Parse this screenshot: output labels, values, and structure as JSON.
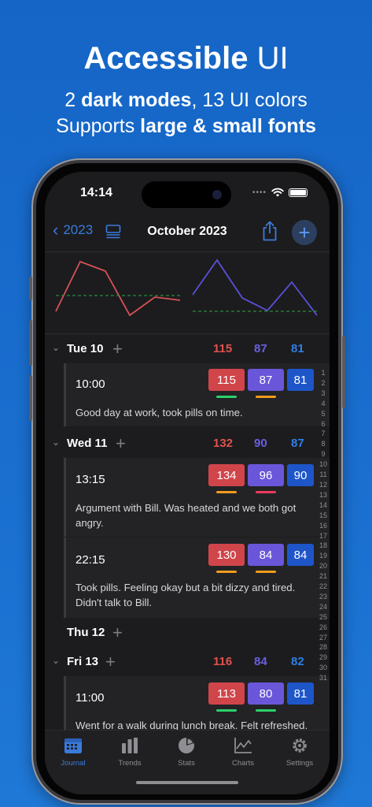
{
  "headline": {
    "bold": "Accessible",
    "rest": "UI"
  },
  "subline1": {
    "prefix": "2 ",
    "bold": "dark modes",
    "suffix": ", 13 UI colors"
  },
  "subline2": {
    "prefix": "Supports ",
    "bold": "large & small fonts"
  },
  "status_bar": {
    "time": "14:14",
    "dots": "••••"
  },
  "nav": {
    "back_label": "2023",
    "title": "October 2023"
  },
  "colors": {
    "systolic": "#e0524f",
    "diastolic": "#6a5fe0",
    "pulse": "#2f7fe8",
    "accent": "#3a7bdc"
  },
  "days": [
    {
      "label": "Tue 10",
      "systolic": "115",
      "diastolic": "87",
      "pulse": "81"
    },
    {
      "label": "Wed 11",
      "systolic": "132",
      "diastolic": "90",
      "pulse": "87"
    },
    {
      "label": "Thu 12"
    },
    {
      "label": "Fri 13",
      "systolic": "116",
      "diastolic": "84",
      "pulse": "82"
    }
  ],
  "entries": [
    {
      "time": "10:00",
      "systolic": "115",
      "diastolic": "87",
      "pulse": "81",
      "note": "Good day at work, took pills on time.",
      "sys_status": "green",
      "dia_status": "orange"
    },
    {
      "time": "13:15",
      "systolic": "134",
      "diastolic": "96",
      "pulse": "90",
      "note": "Argument with Bill. Was heated and we both got angry.",
      "sys_status": "orange",
      "dia_status": "red"
    },
    {
      "time": "22:15",
      "systolic": "130",
      "diastolic": "84",
      "pulse": "84",
      "note": "Took pills. Feeling okay but a bit dizzy and tired. Didn't talk to Bill.",
      "sys_status": "orange",
      "dia_status": "orange"
    },
    {
      "time": "11:00",
      "systolic": "113",
      "diastolic": "80",
      "pulse": "81",
      "note": "Went for a walk during lunch break. Felt refreshed.",
      "sys_status": "green",
      "dia_status": "green"
    }
  ],
  "day_index": [
    "1",
    "2",
    "3",
    "4",
    "5",
    "6",
    "7",
    "8",
    "9",
    "10",
    "11",
    "12",
    "13",
    "14",
    "15",
    "16",
    "17",
    "18",
    "19",
    "20",
    "21",
    "22",
    "23",
    "24",
    "25",
    "26",
    "27",
    "28",
    "29",
    "30",
    "31"
  ],
  "tabs": [
    {
      "label": "Journal",
      "icon": "calendar-icon",
      "active": true
    },
    {
      "label": "Trends",
      "icon": "bar-chart-icon",
      "active": false
    },
    {
      "label": "Stats",
      "icon": "pie-chart-icon",
      "active": false
    },
    {
      "label": "Charts",
      "icon": "line-chart-icon",
      "active": false
    },
    {
      "label": "Settings",
      "icon": "gear-icon",
      "active": false
    }
  ]
}
